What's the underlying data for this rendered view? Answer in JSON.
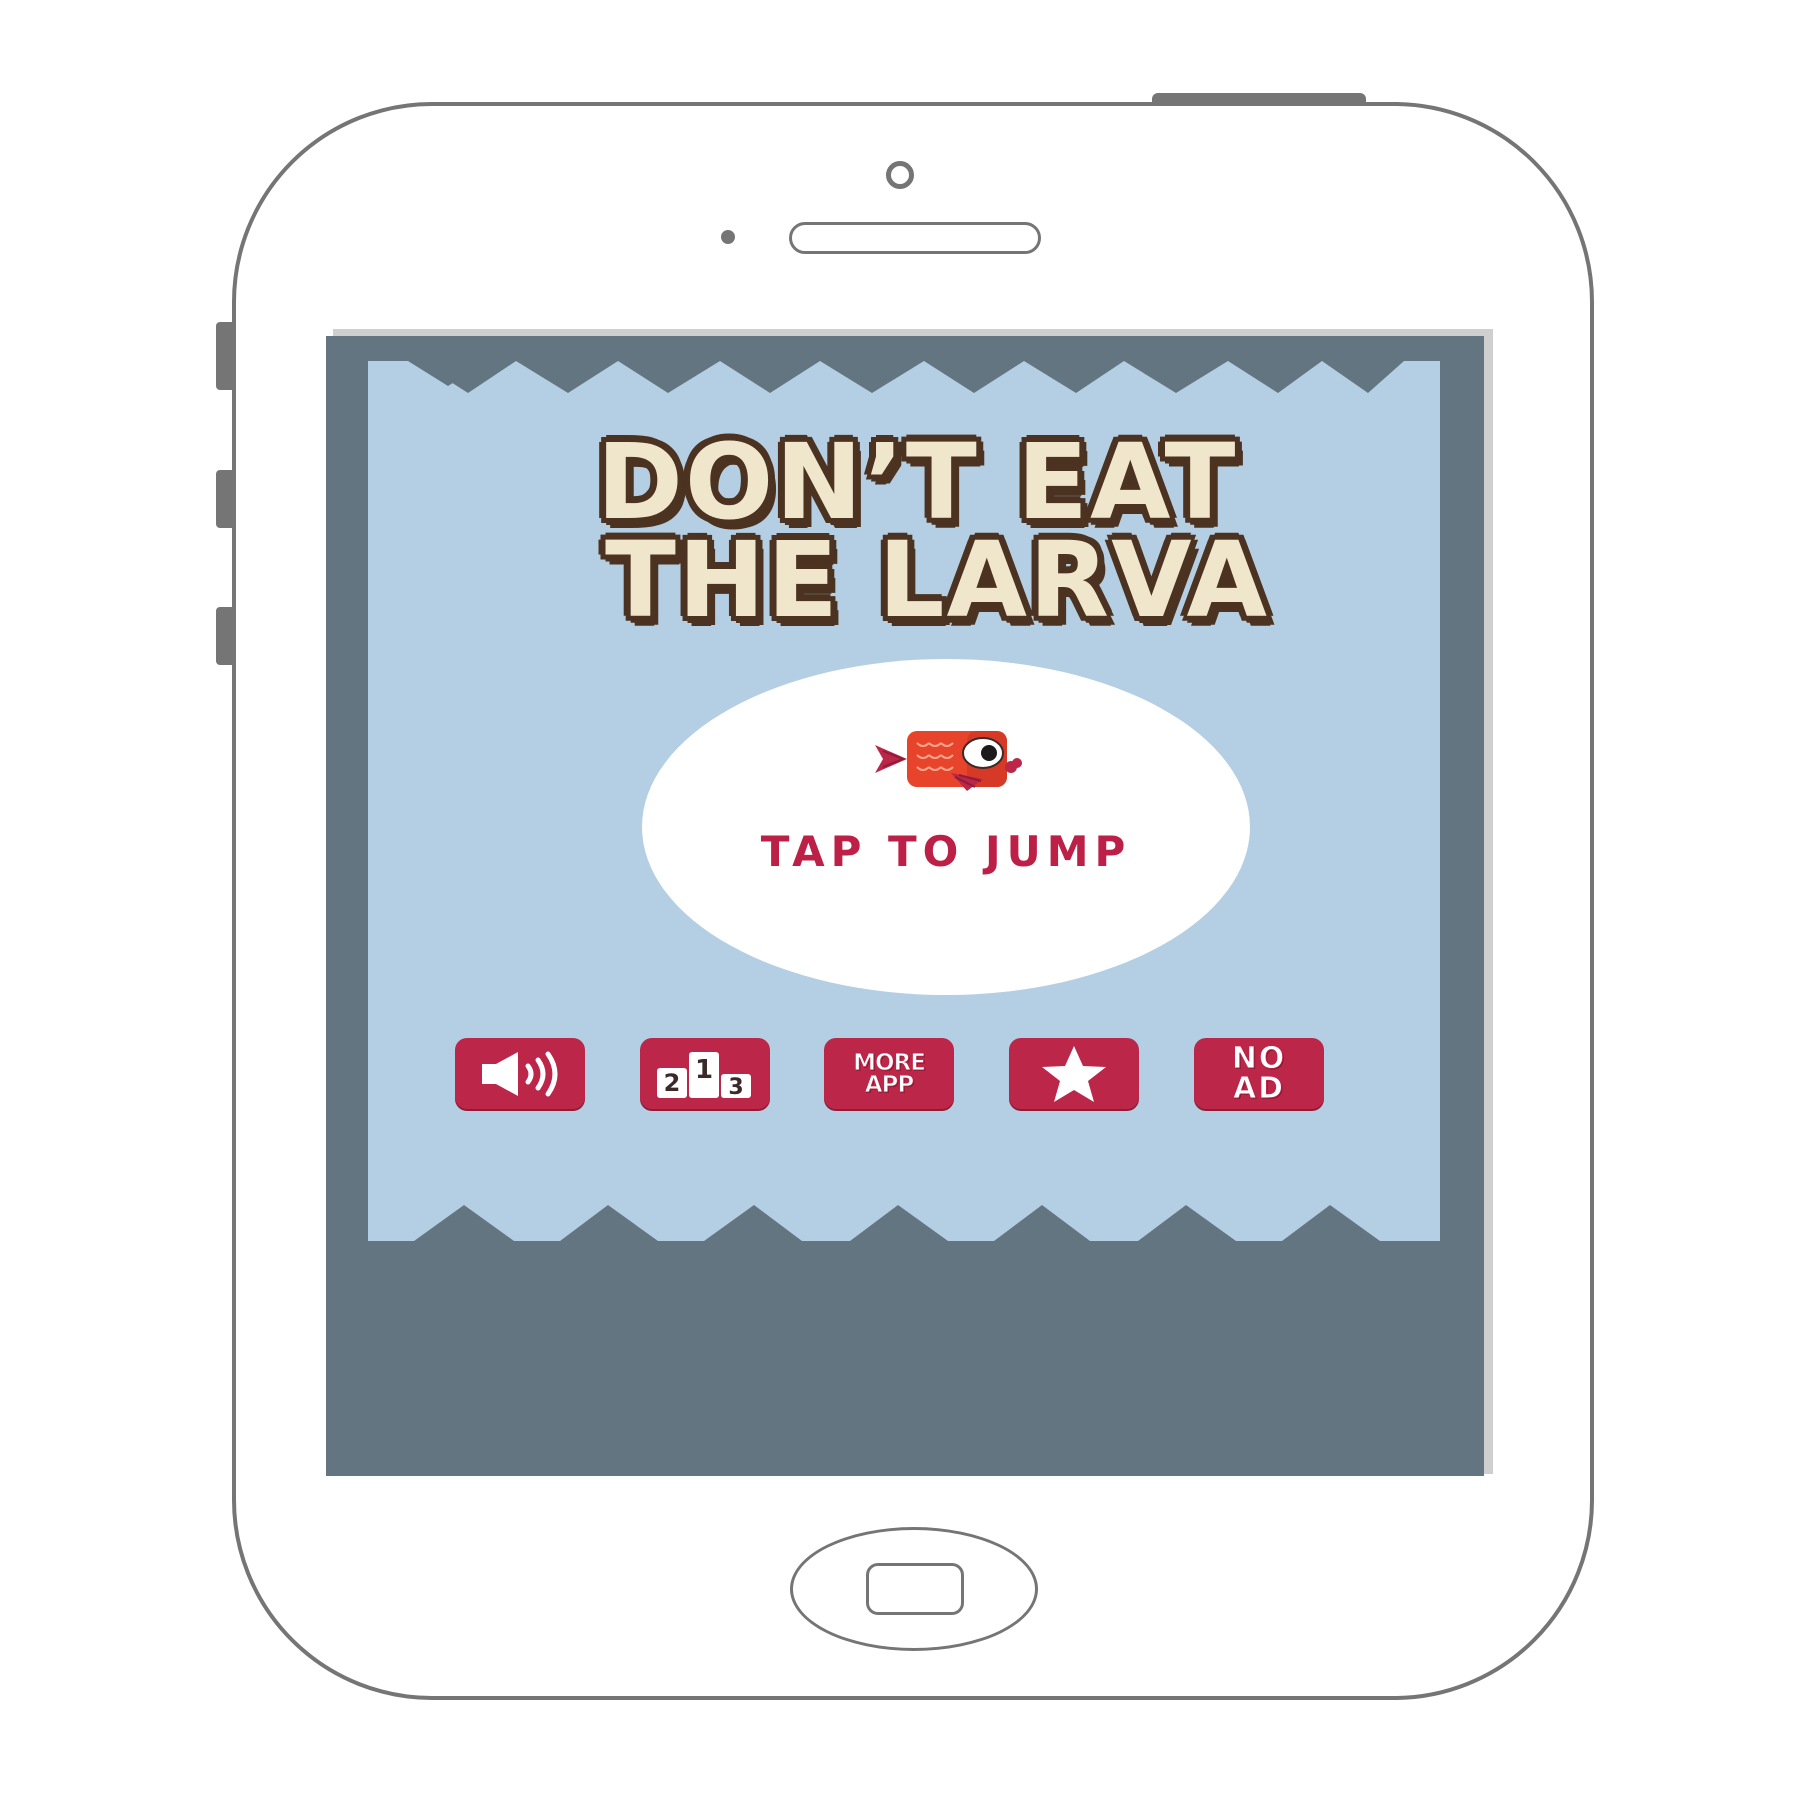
{
  "app": {
    "title_line1": "DON’T EAT",
    "title_line2": "THE LARVA",
    "tap_prompt": "TAP TO JUMP"
  },
  "buttons": {
    "sound": {
      "icon": "speaker-icon"
    },
    "leaderboard": {
      "icon": "podium-icon",
      "rank_labels": [
        "2",
        "1",
        "3"
      ]
    },
    "more_apps": {
      "label_line1": "MORE",
      "label_line2": "APP"
    },
    "rate": {
      "icon": "star-icon"
    },
    "no_ad": {
      "label_line1": "NO",
      "label_line2": "AD"
    }
  },
  "colors": {
    "frame": "#647582",
    "play_area": "#b4cfe3",
    "title_fill": "#efe6cc",
    "title_outline": "#4b3221",
    "accent": "#bc2749",
    "fish": "#e8432b"
  }
}
